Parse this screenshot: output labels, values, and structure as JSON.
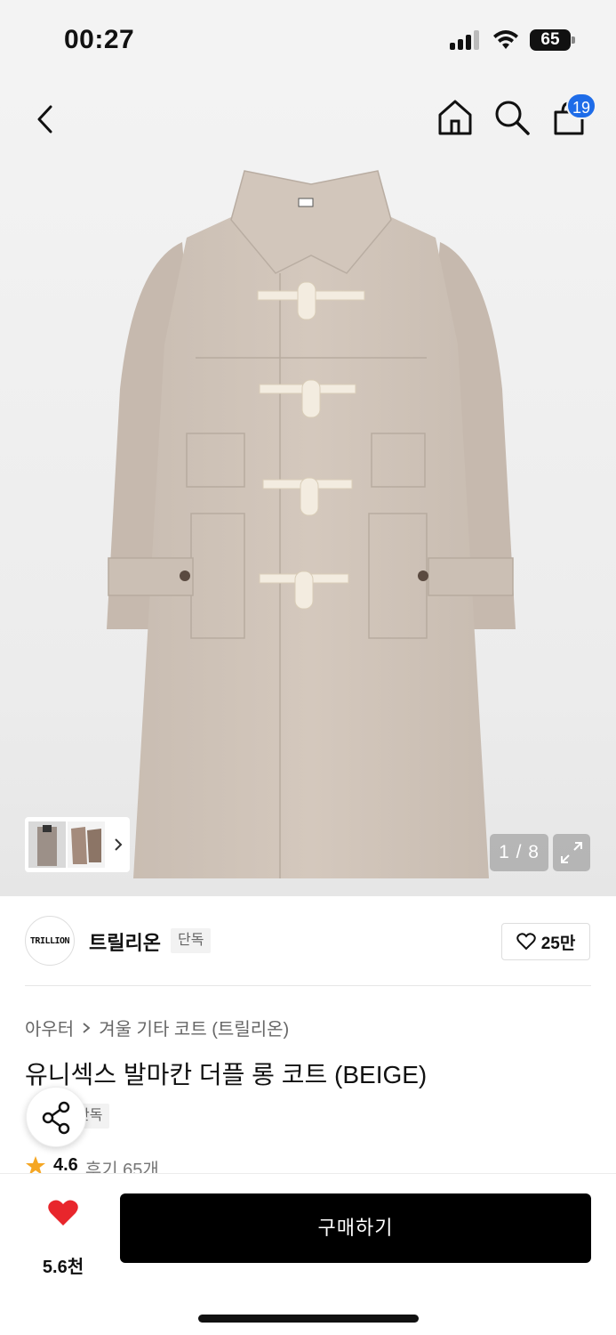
{
  "status_bar": {
    "time": "00:27",
    "battery": "65"
  },
  "header": {
    "cart_count": "19"
  },
  "gallery": {
    "counter": "1 / 8"
  },
  "brand": {
    "logo_text": "TRILLION",
    "name": "트릴리온",
    "tag": "단독",
    "likes": "25만"
  },
  "breadcrumb": {
    "category": "아우터",
    "sub": "겨울 기타 코트 (트릴리온)"
  },
  "product": {
    "title": "유니섹스 발마칸 더플 롱 코트 (BEIGE)",
    "tag": "단독",
    "rating": "4.6",
    "reviews": "후기 65개"
  },
  "bottom_bar": {
    "wish_count": "5.6천",
    "buy_label": "구매하기"
  },
  "colors": {
    "accent_badge": "#1e6ce8",
    "buy_button": "#000000",
    "heart": "#e8262c",
    "star": "#f5a623",
    "coat": "#cfc3b8"
  }
}
